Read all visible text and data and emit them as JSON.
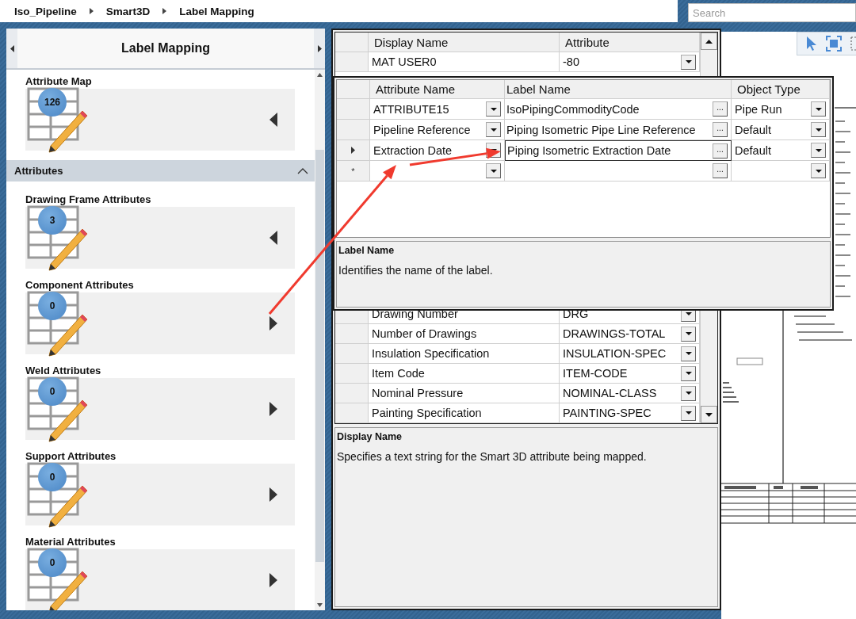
{
  "breadcrumb": [
    "Iso_Pipeline",
    "Smart3D",
    "Label Mapping"
  ],
  "search": {
    "placeholder": "Search"
  },
  "panel": {
    "title": "Label Mapping",
    "attribute_map": {
      "label": "Attribute Map",
      "count": "126",
      "expanded": true
    },
    "group": {
      "label": "Attributes",
      "expanded": true,
      "items": [
        {
          "label": "Drawing Frame Attributes",
          "count": "3",
          "expanded": true
        },
        {
          "label": "Component Attributes",
          "count": "0",
          "expanded": false
        },
        {
          "label": "Weld Attributes",
          "count": "0",
          "expanded": false
        },
        {
          "label": "Support Attributes",
          "count": "0",
          "expanded": false
        },
        {
          "label": "Material Attributes",
          "count": "0",
          "expanded": false
        }
      ]
    }
  },
  "mapping_grid": {
    "columns": [
      "Display Name",
      "Attribute"
    ],
    "rows": [
      {
        "display_name": "MAT USER0",
        "attribute": "-80"
      },
      {
        "display_name": "Drawing Number",
        "attribute": "DRG"
      },
      {
        "display_name": "Number of Drawings",
        "attribute": "DRAWINGS-TOTAL"
      },
      {
        "display_name": "Insulation Specification",
        "attribute": "INSULATION-SPEC"
      },
      {
        "display_name": "Item Code",
        "attribute": "ITEM-CODE"
      },
      {
        "display_name": "Nominal Pressure",
        "attribute": "NOMINAL-CLASS"
      },
      {
        "display_name": "Painting Specification",
        "attribute": "PAINTING-SPEC"
      }
    ],
    "help": {
      "title": "Display Name",
      "text": "Specifies a text string for the Smart 3D attribute being mapped."
    }
  },
  "label_dialog": {
    "columns": [
      "Attribute Name",
      "Label Name",
      "Object Type"
    ],
    "rows": [
      {
        "attribute_name": "ATTRIBUTE15",
        "label_name": "IsoPipingCommodityCode",
        "object_type": "Pipe Run",
        "current": false,
        "browse": "..."
      },
      {
        "attribute_name": "Pipeline Reference",
        "label_name": "Piping Isometric Pipe Line Reference",
        "object_type": "Default",
        "current": false,
        "browse": "..."
      },
      {
        "attribute_name": "Extraction Date",
        "label_name": "Piping Isometric Extraction Date",
        "object_type": "Default",
        "current": true,
        "browse": "..."
      }
    ],
    "new_row": {
      "marker": "*",
      "browse": "..."
    },
    "help": {
      "title": "Label Name",
      "text": "Identifies the name of the label."
    }
  }
}
